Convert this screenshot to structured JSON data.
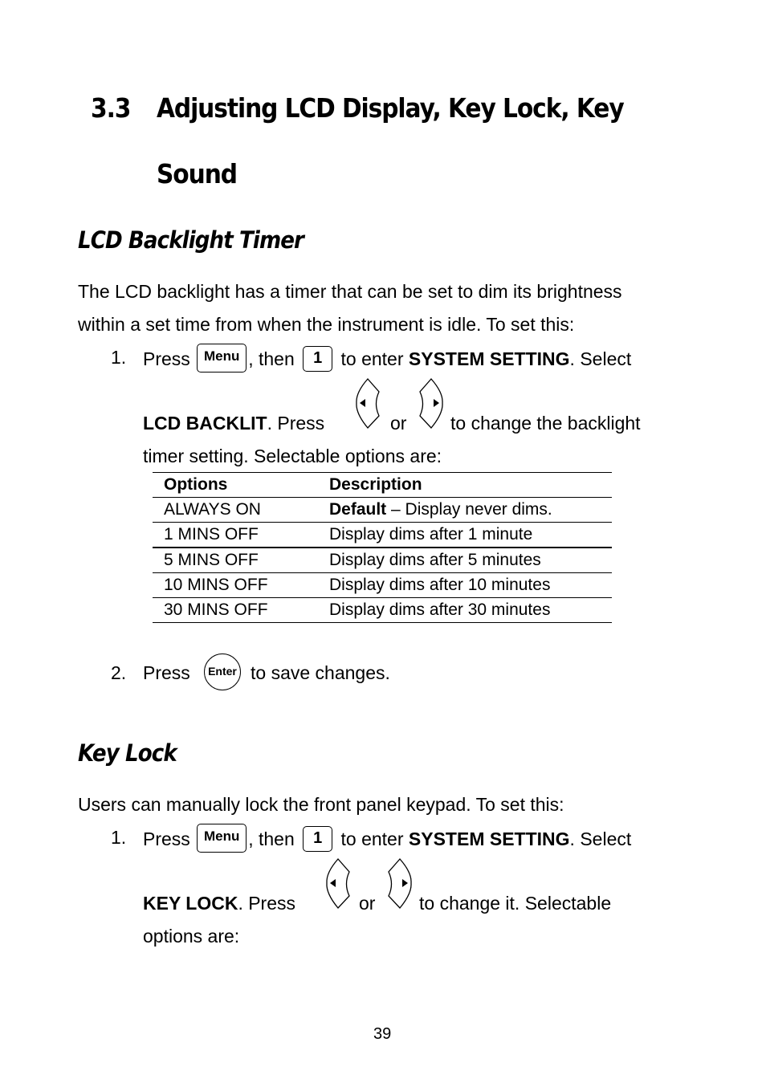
{
  "section": {
    "number": "3.3",
    "title_line1": "Adjusting LCD Display, Key Lock, Key",
    "title_line2": "Sound"
  },
  "backlight": {
    "heading": "LCD Backlight Timer",
    "intro_line1": "The LCD backlight has a timer that can be set to dim its brightness",
    "intro_line2": "within a set time from when the instrument is idle.  To set this:",
    "step1": {
      "num": "1.",
      "press": "Press",
      "key_menu": "Menu",
      "then": ", then",
      "key_one": "1",
      "to_enter": "to enter",
      "system_setting": "SYSTEM SETTING",
      "select": ".  Select",
      "item": "LCD BACKLIT",
      "press2": ".  Press",
      "or": "or",
      "tail": "to change the backlight",
      "line3": "timer setting. Selectable options are:"
    },
    "table": {
      "headers": [
        "Options",
        "Description"
      ],
      "rows": [
        {
          "option": "ALWAYS ON",
          "desc_bold": "Default",
          "desc": " – Display never dims."
        },
        {
          "option": "1 MINS OFF",
          "desc_bold": "",
          "desc": "Display dims after 1 minute"
        },
        {
          "option": "5 MINS OFF",
          "desc_bold": "",
          "desc": "Display dims after 5 minutes"
        },
        {
          "option": "10 MINS OFF",
          "desc_bold": "",
          "desc": "Display dims after 10 minutes"
        },
        {
          "option": "30 MINS OFF",
          "desc_bold": "",
          "desc": "Display dims after 30 minutes"
        }
      ]
    },
    "step2": {
      "num": "2.",
      "press": "Press",
      "key_enter": "Enter",
      "tail": "to save changes."
    }
  },
  "keylock": {
    "heading": "Key Lock",
    "intro": "Users can manually lock the front panel keypad.  To set this:",
    "step1": {
      "num": "1.",
      "press": "Press",
      "key_menu": "Menu",
      "then": ", then",
      "key_one": "1",
      "to_enter": "to enter",
      "system_setting": "SYSTEM SETTING",
      "select": ".  Select",
      "item": "KEY LOCK",
      "press2": ".  Press",
      "or": "or",
      "tail": "to change it. Selectable",
      "line3": "options are:"
    }
  },
  "icons": {
    "left": "left-arrow-key-icon",
    "right": "right-arrow-key-icon"
  },
  "page_number": "39"
}
